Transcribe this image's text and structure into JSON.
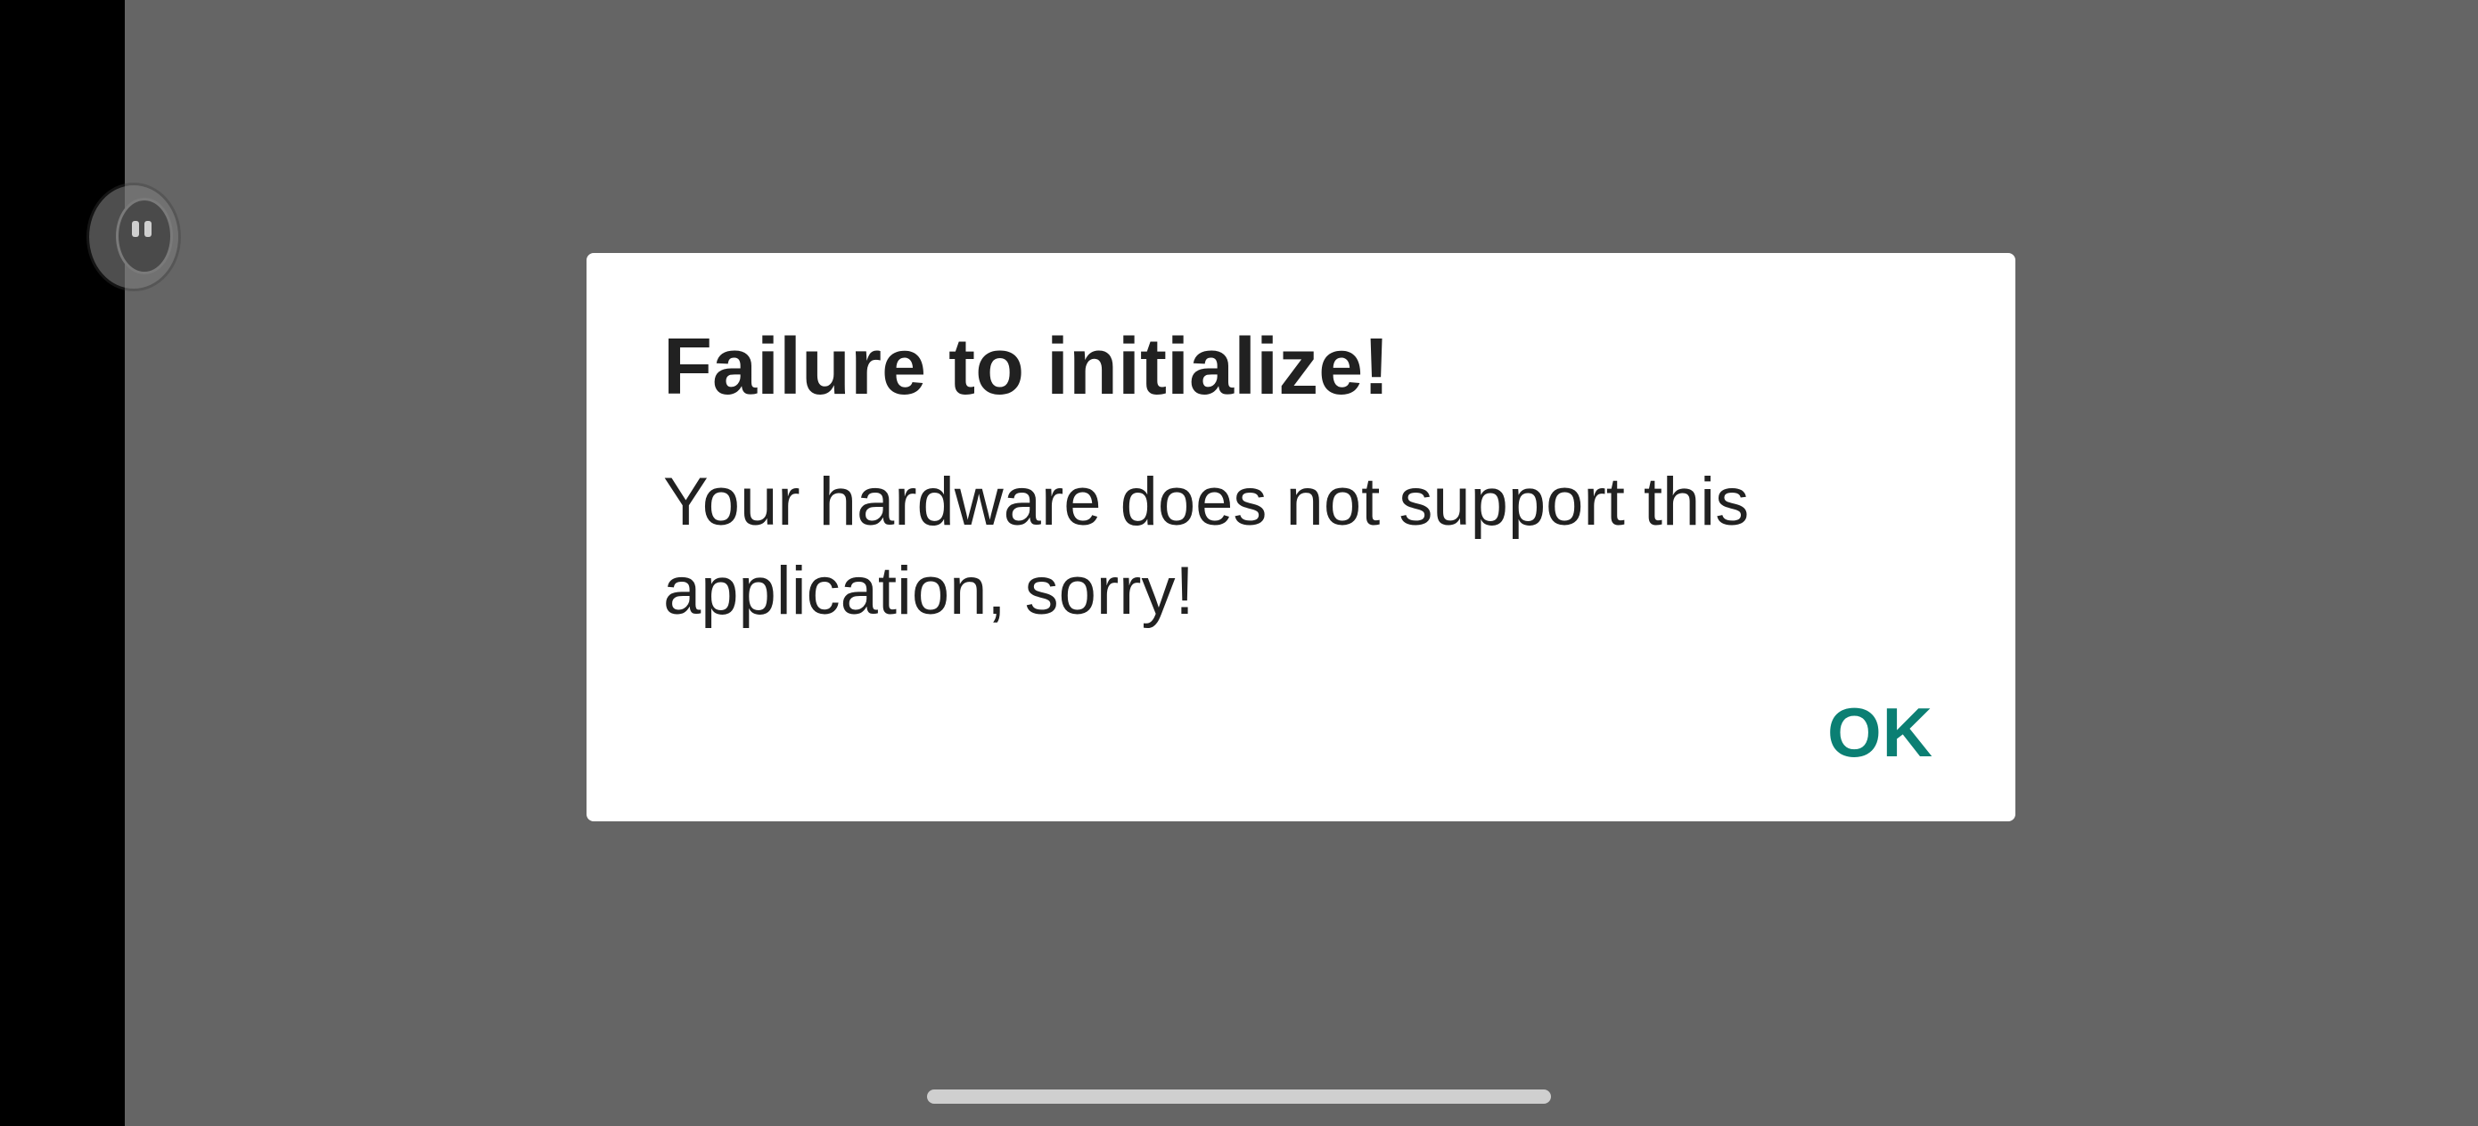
{
  "dialog": {
    "title": "Failure to initialize!",
    "message": "Your hardware does not support this application, sorry!",
    "ok_label": "OK"
  },
  "colors": {
    "scrim": "#656565",
    "dialog_background": "#ffffff",
    "text": "#212121",
    "accent": "#0b7f73"
  },
  "icons": {
    "floating_bubble": "pause-bubble-icon",
    "home_handle": "gesture-navigation-handle"
  }
}
